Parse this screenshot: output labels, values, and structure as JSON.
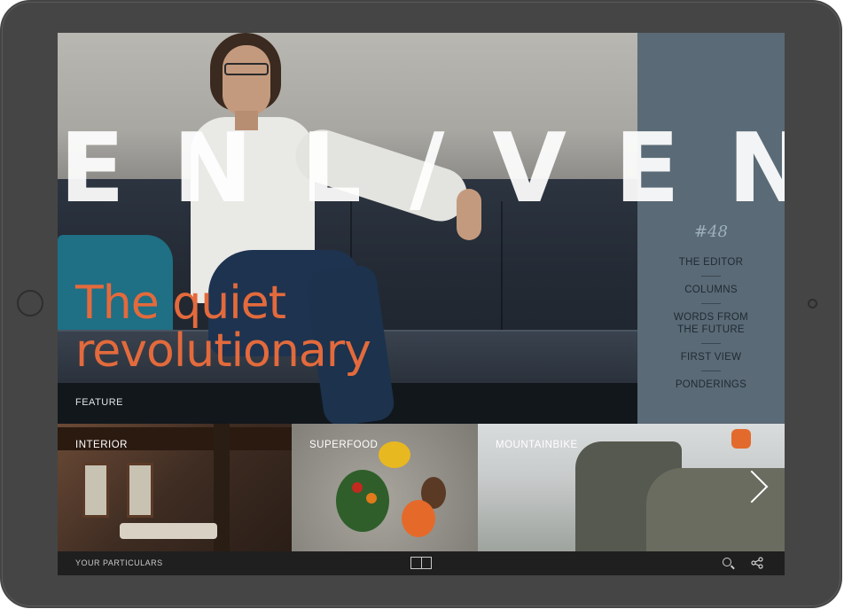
{
  "magazine": {
    "masthead": "ENL/VEN",
    "issue": "#48"
  },
  "feature": {
    "title": "The quiet revolutionary",
    "label": "FEATURE"
  },
  "nav": {
    "items": [
      {
        "label": "THE EDITOR"
      },
      {
        "label": "COLUMNS"
      },
      {
        "label_line1": "WORDS FROM",
        "label_line2": "THE FUTURE"
      },
      {
        "label": "FIRST VIEW"
      },
      {
        "label": "PONDERINGS"
      }
    ]
  },
  "tiles": [
    {
      "label": "INTERIOR"
    },
    {
      "label": "SUPERFOOD"
    },
    {
      "label": "MOUNTAINBIKE"
    }
  ],
  "footer": {
    "label": "YOUR PARTICULARS"
  },
  "icons": {
    "next": "chevron-right-icon",
    "layout": "pages-icon",
    "search": "search-icon",
    "share": "share-icon"
  },
  "colors": {
    "accent": "#e36a3c",
    "sidebar": "#5f6f7a",
    "footer": "#1f1f20",
    "device": "#454545"
  }
}
